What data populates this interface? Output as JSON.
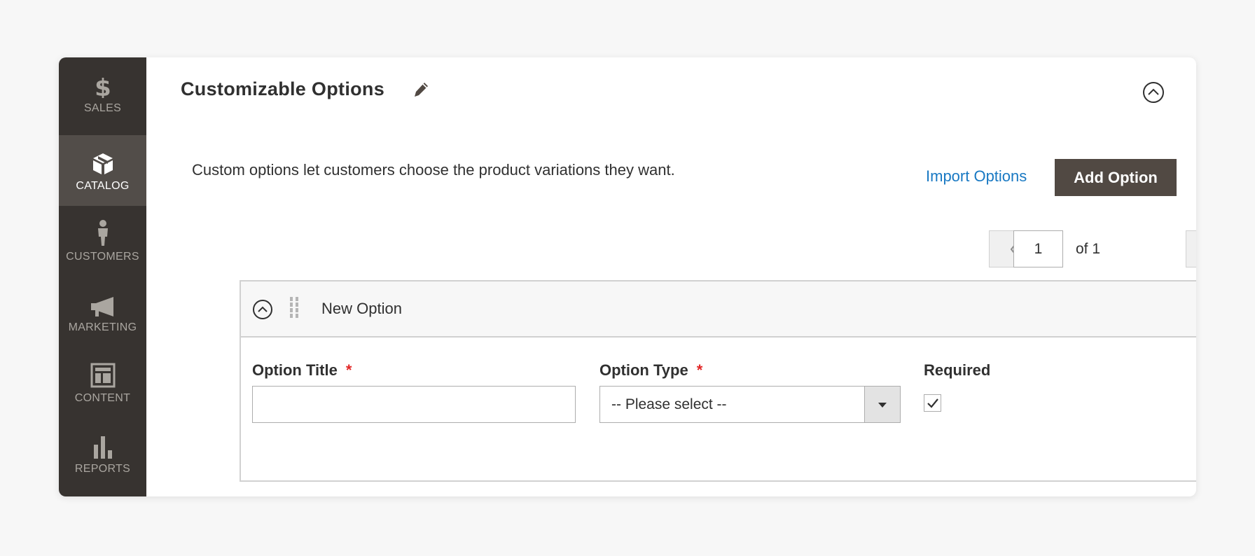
{
  "sidebar": {
    "items": [
      {
        "label": "SALES",
        "icon": "dollar-icon",
        "active": false
      },
      {
        "label": "CATALOG",
        "icon": "cube-icon",
        "active": true
      },
      {
        "label": "CUSTOMERS",
        "icon": "person-icon",
        "active": false
      },
      {
        "label": "MARKETING",
        "icon": "megaphone-icon",
        "active": false
      },
      {
        "label": "CONTENT",
        "icon": "layout-icon",
        "active": false
      },
      {
        "label": "REPORTS",
        "icon": "bar-chart-icon",
        "active": false
      }
    ]
  },
  "section": {
    "title": "Customizable Options",
    "description": "Custom options let customers choose the product variations they want.",
    "import_label": "Import Options",
    "add_label": "Add Option"
  },
  "pager": {
    "current": "1",
    "total_text": "of 1"
  },
  "option": {
    "name": "New Option",
    "title_label": "Option Title",
    "title_value": "",
    "type_label": "Option Type",
    "type_value": "-- Please select --",
    "required_label": "Required",
    "required_marker": "*",
    "required_checked": true
  },
  "colors": {
    "sidebar_bg": "#373330",
    "sidebar_active": "#524d49",
    "primary_button": "#514943",
    "link": "#1979c3",
    "required_star": "#e22626"
  }
}
